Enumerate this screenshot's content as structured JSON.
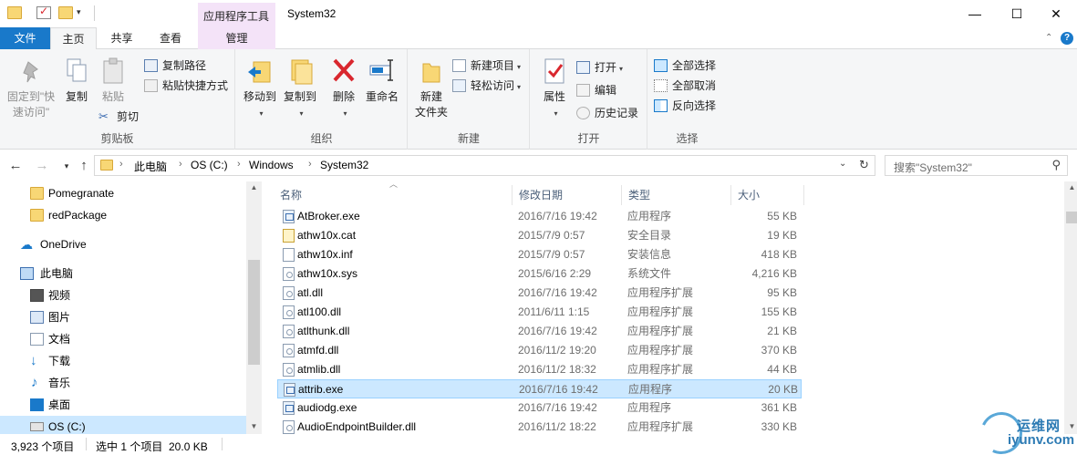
{
  "titlebar": {
    "context_tab_title": "应用程序工具",
    "window_title": "System32",
    "minimize": "—",
    "maximize": "☐",
    "close": "✕"
  },
  "tabs": {
    "file": "文件",
    "home": "主页",
    "share": "共享",
    "view": "查看",
    "manage": "管理"
  },
  "ribbon": {
    "clipboard": {
      "label": "剪贴板",
      "pin_line1": "固定到\"快",
      "pin_line2": "速访问\"",
      "copy": "复制",
      "paste": "粘贴",
      "copy_path": "复制路径",
      "paste_shortcut": "粘贴快捷方式",
      "cut": "剪切"
    },
    "organize": {
      "label": "组织",
      "move_to": "移动到",
      "copy_to": "复制到",
      "delete": "删除",
      "rename": "重命名"
    },
    "new": {
      "label": "新建",
      "new_folder_line1": "新建",
      "new_folder_line2": "文件夹",
      "new_item": "新建项目",
      "easy_access": "轻松访问"
    },
    "open": {
      "label": "打开",
      "properties": "属性",
      "open": "打开",
      "edit": "编辑",
      "history": "历史记录"
    },
    "select": {
      "label": "选择",
      "select_all": "全部选择",
      "select_none": "全部取消",
      "invert": "反向选择"
    }
  },
  "address": {
    "crumbs": [
      "此电脑",
      "OS (C:)",
      "Windows",
      "System32"
    ],
    "search_placeholder": "搜索\"System32\""
  },
  "nav": {
    "items": [
      {
        "label": "Pomegranate",
        "icon": "folder-icon"
      },
      {
        "label": "redPackage",
        "icon": "folder-icon"
      },
      {
        "label": "OneDrive",
        "icon": "cloud-icon"
      },
      {
        "label": "此电脑",
        "icon": "computer-icon"
      },
      {
        "label": "视频",
        "icon": "video-icon"
      },
      {
        "label": "图片",
        "icon": "picture-icon"
      },
      {
        "label": "文档",
        "icon": "document-icon"
      },
      {
        "label": "下载",
        "icon": "download-icon"
      },
      {
        "label": "音乐",
        "icon": "music-icon"
      },
      {
        "label": "桌面",
        "icon": "desktop-icon"
      },
      {
        "label": "OS (C:)",
        "icon": "drive-icon"
      }
    ]
  },
  "filelist": {
    "columns": {
      "name": "名称",
      "date": "修改日期",
      "type": "类型",
      "size": "大小"
    },
    "rows": [
      {
        "name": "AtBroker.exe",
        "date": "2016/7/16 19:42",
        "type": "应用程序",
        "size": "55 KB",
        "kind": "exe"
      },
      {
        "name": "athw10x.cat",
        "date": "2015/7/9 0:57",
        "type": "安全目录",
        "size": "19 KB",
        "kind": "cat"
      },
      {
        "name": "athw10x.inf",
        "date": "2015/7/9 0:57",
        "type": "安装信息",
        "size": "418 KB",
        "kind": "inf"
      },
      {
        "name": "athw10x.sys",
        "date": "2015/6/16 2:29",
        "type": "系统文件",
        "size": "4,216 KB",
        "kind": "dll"
      },
      {
        "name": "atl.dll",
        "date": "2016/7/16 19:42",
        "type": "应用程序扩展",
        "size": "95 KB",
        "kind": "dll"
      },
      {
        "name": "atl100.dll",
        "date": "2011/6/11 1:15",
        "type": "应用程序扩展",
        "size": "155 KB",
        "kind": "dll"
      },
      {
        "name": "atlthunk.dll",
        "date": "2016/7/16 19:42",
        "type": "应用程序扩展",
        "size": "21 KB",
        "kind": "dll"
      },
      {
        "name": "atmfd.dll",
        "date": "2016/11/2 19:20",
        "type": "应用程序扩展",
        "size": "370 KB",
        "kind": "dll"
      },
      {
        "name": "atmlib.dll",
        "date": "2016/11/2 18:32",
        "type": "应用程序扩展",
        "size": "44 KB",
        "kind": "dll"
      },
      {
        "name": "attrib.exe",
        "date": "2016/7/16 19:42",
        "type": "应用程序",
        "size": "20 KB",
        "kind": "exe"
      },
      {
        "name": "audiodg.exe",
        "date": "2016/7/16 19:42",
        "type": "应用程序",
        "size": "361 KB",
        "kind": "exe"
      },
      {
        "name": "AudioEndpointBuilder.dll",
        "date": "2016/11/2 18:22",
        "type": "应用程序扩展",
        "size": "330 KB",
        "kind": "dll"
      }
    ]
  },
  "status": {
    "count": "3,923 个项目",
    "selection": "选中 1 个项目  20.0 KB"
  },
  "watermark": {
    "line1": "运维网",
    "line2": "iyunv.com"
  }
}
